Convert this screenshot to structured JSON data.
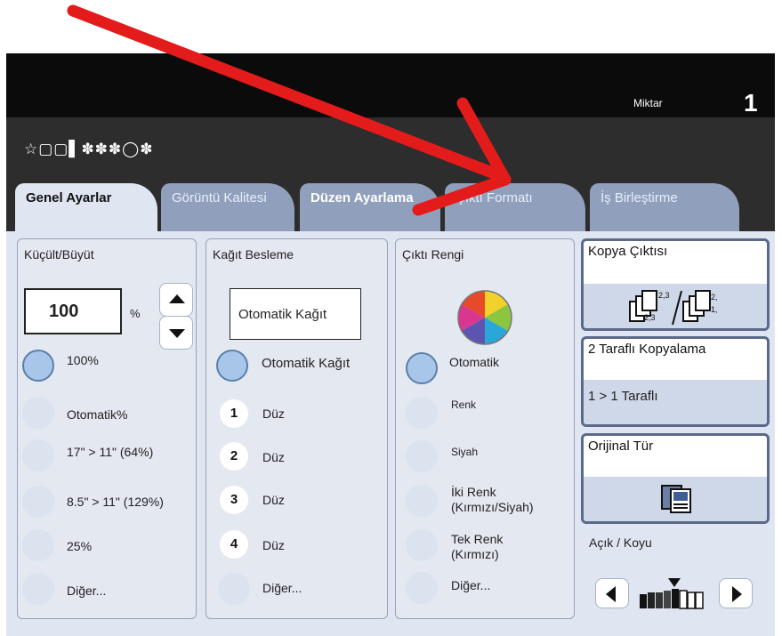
{
  "header": {
    "quantity_label": "Miktar",
    "quantity_value": "1",
    "status_glyphs": "☆▢▢▌✽✽✽◯✽"
  },
  "tabs": [
    {
      "label": "Genel Ayarlar"
    },
    {
      "label": "Görüntü Kalitesi"
    },
    {
      "label": "Düzen Ayarlama"
    },
    {
      "label": "Çıktı Formatı"
    },
    {
      "label": "İş Birleştirme"
    }
  ],
  "reduce_enlarge": {
    "title": "Küçült/Büyüt",
    "value": "100",
    "unit": "%",
    "options": [
      "100%",
      "Otomatik%",
      "17\" > 11\" (64%)",
      "8.5\" > 11\" (129%)",
      "25%",
      "Diğer..."
    ]
  },
  "paper_supply": {
    "title": "Kağıt Besleme",
    "value": "Otomatik Kağıt",
    "options": [
      {
        "badge": "",
        "label": "Otomatik Kağıt"
      },
      {
        "badge": "1",
        "label": "Düz"
      },
      {
        "badge": "2",
        "label": "Düz"
      },
      {
        "badge": "3",
        "label": "Düz"
      },
      {
        "badge": "4",
        "label": "Düz"
      },
      {
        "badge": "",
        "label": "Diğer..."
      }
    ]
  },
  "output_color": {
    "title": "Çıktı Rengi",
    "options": [
      "Otomatik",
      "Renk",
      "Siyah",
      "İki Renk\n(Kırmızı/Siyah)",
      "Tek Renk\n(Kırmızı)",
      "Diğer..."
    ]
  },
  "copy_output": {
    "title": "Kopya Çıktısı",
    "icon": "collated-copies-icon"
  },
  "two_sided": {
    "title": "2 Taraflı Kopyalama",
    "value": "1 > 1 Taraflı"
  },
  "original_type": {
    "title": "Orijinal Tür",
    "icon": "document-type-icon"
  },
  "lighten_darken": {
    "title": "Açık / Koyu",
    "level": 0.5
  },
  "colors": {
    "tab_inactive": "#8f9fbc",
    "panel": "#dfe6f1",
    "selected": "#a8c6ea",
    "annotation_arrow": "#e31b1b"
  }
}
